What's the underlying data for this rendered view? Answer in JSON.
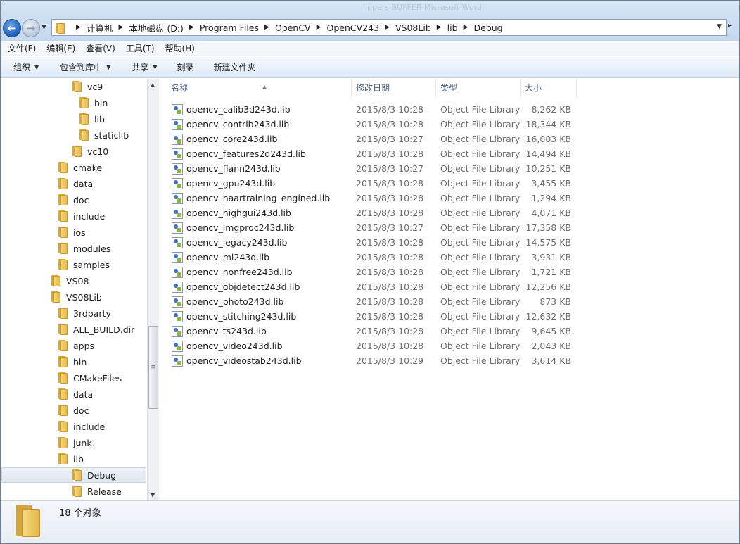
{
  "window": {
    "title": "lippers-BUFFER-Microsoft Word"
  },
  "address": {
    "breadcrumbs": [
      "计算机",
      "本地磁盘 (D:)",
      "Program Files",
      "OpenCV",
      "OpenCV243",
      "VS08Lib",
      "lib",
      "Debug"
    ]
  },
  "menu": [
    "文件(F)",
    "编辑(E)",
    "查看(V)",
    "工具(T)",
    "帮助(H)"
  ],
  "toolbar": {
    "organize": "组织",
    "include_in_library": "包含到库中",
    "share": "共享",
    "burn": "刻录",
    "new_folder": "新建文件夹"
  },
  "tree": [
    {
      "label": "vc9",
      "depth": 2
    },
    {
      "label": "bin",
      "depth": 3
    },
    {
      "label": "lib",
      "depth": 3
    },
    {
      "label": "staticlib",
      "depth": 3
    },
    {
      "label": "vc10",
      "depth": 2
    },
    {
      "label": "cmake",
      "depth": 1
    },
    {
      "label": "data",
      "depth": 1
    },
    {
      "label": "doc",
      "depth": 1
    },
    {
      "label": "include",
      "depth": 1
    },
    {
      "label": "ios",
      "depth": 1
    },
    {
      "label": "modules",
      "depth": 1
    },
    {
      "label": "samples",
      "depth": 1
    },
    {
      "label": "VS08",
      "depth": 0
    },
    {
      "label": "VS08Lib",
      "depth": 0
    },
    {
      "label": "3rdparty",
      "depth": 1
    },
    {
      "label": "ALL_BUILD.dir",
      "depth": 1
    },
    {
      "label": "apps",
      "depth": 1
    },
    {
      "label": "bin",
      "depth": 1
    },
    {
      "label": "CMakeFiles",
      "depth": 1
    },
    {
      "label": "data",
      "depth": 1
    },
    {
      "label": "doc",
      "depth": 1
    },
    {
      "label": "include",
      "depth": 1
    },
    {
      "label": "junk",
      "depth": 1
    },
    {
      "label": "lib",
      "depth": 1
    },
    {
      "label": "Debug",
      "depth": 2,
      "selected": true
    },
    {
      "label": "Release",
      "depth": 2
    }
  ],
  "columns": {
    "name": "名称",
    "date": "修改日期",
    "type": "类型",
    "size": "大小"
  },
  "files": [
    {
      "name": "opencv_calib3d243d.lib",
      "date": "2015/8/3 10:28",
      "type": "Object File Library",
      "size": "8,262 KB"
    },
    {
      "name": "opencv_contrib243d.lib",
      "date": "2015/8/3 10:28",
      "type": "Object File Library",
      "size": "18,344 KB"
    },
    {
      "name": "opencv_core243d.lib",
      "date": "2015/8/3 10:27",
      "type": "Object File Library",
      "size": "16,003 KB"
    },
    {
      "name": "opencv_features2d243d.lib",
      "date": "2015/8/3 10:28",
      "type": "Object File Library",
      "size": "14,494 KB"
    },
    {
      "name": "opencv_flann243d.lib",
      "date": "2015/8/3 10:27",
      "type": "Object File Library",
      "size": "10,251 KB"
    },
    {
      "name": "opencv_gpu243d.lib",
      "date": "2015/8/3 10:28",
      "type": "Object File Library",
      "size": "3,455 KB"
    },
    {
      "name": "opencv_haartraining_engined.lib",
      "date": "2015/8/3 10:28",
      "type": "Object File Library",
      "size": "1,294 KB"
    },
    {
      "name": "opencv_highgui243d.lib",
      "date": "2015/8/3 10:28",
      "type": "Object File Library",
      "size": "4,071 KB"
    },
    {
      "name": "opencv_imgproc243d.lib",
      "date": "2015/8/3 10:27",
      "type": "Object File Library",
      "size": "17,358 KB"
    },
    {
      "name": "opencv_legacy243d.lib",
      "date": "2015/8/3 10:28",
      "type": "Object File Library",
      "size": "14,575 KB"
    },
    {
      "name": "opencv_ml243d.lib",
      "date": "2015/8/3 10:28",
      "type": "Object File Library",
      "size": "3,931 KB"
    },
    {
      "name": "opencv_nonfree243d.lib",
      "date": "2015/8/3 10:28",
      "type": "Object File Library",
      "size": "1,721 KB"
    },
    {
      "name": "opencv_objdetect243d.lib",
      "date": "2015/8/3 10:28",
      "type": "Object File Library",
      "size": "12,256 KB"
    },
    {
      "name": "opencv_photo243d.lib",
      "date": "2015/8/3 10:28",
      "type": "Object File Library",
      "size": "873 KB"
    },
    {
      "name": "opencv_stitching243d.lib",
      "date": "2015/8/3 10:28",
      "type": "Object File Library",
      "size": "12,632 KB"
    },
    {
      "name": "opencv_ts243d.lib",
      "date": "2015/8/3 10:28",
      "type": "Object File Library",
      "size": "9,645 KB"
    },
    {
      "name": "opencv_video243d.lib",
      "date": "2015/8/3 10:28",
      "type": "Object File Library",
      "size": "2,043 KB"
    },
    {
      "name": "opencv_videostab243d.lib",
      "date": "2015/8/3 10:29",
      "type": "Object File Library",
      "size": "3,614 KB"
    }
  ],
  "status": {
    "item_count": "18 个对象"
  },
  "colors": {
    "chrome": "#cfe0f3",
    "selection": "#dfe6ee",
    "folder": "#e7b84a",
    "header_text": "#4c5f78",
    "secondary_text": "#6d6d6d"
  }
}
